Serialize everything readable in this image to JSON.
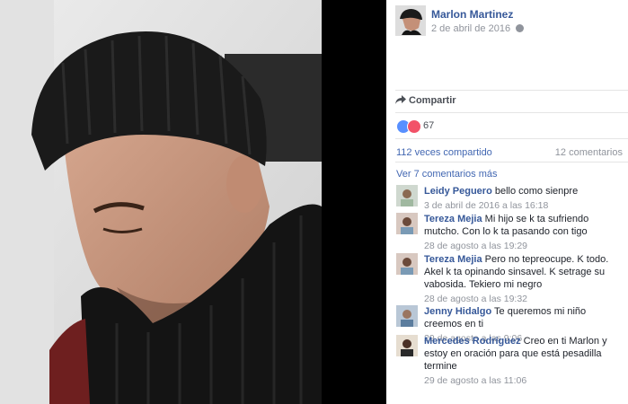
{
  "post": {
    "author": "Marlon Martinez",
    "date": "2 de abril de 2016",
    "privacy_icon": "globe-icon",
    "share_label": "Compartir",
    "reaction_count": "67",
    "shares_text": "112 veces compartido",
    "comments_text": "12 comentarios",
    "view_more": "Ver 7 comentarios más"
  },
  "comments": [
    {
      "author": "Leidy Peguero",
      "text": "bello como sienpre",
      "time": "3 de abril de 2016 a las 16:18"
    },
    {
      "author": "Tereza Mejia",
      "text": "Mi hijo se k ta sufriendo mutcho. Con lo k ta pasando con tigo",
      "time": "28 de agosto a las 19:29"
    },
    {
      "author": "Tereza Mejia",
      "text": "Pero no tepreocupe. K todo. Akel k ta opinando sinsavel. K setragе su vabosida. Tekiero mi negro",
      "time": "28 de agosto a las 19:32"
    },
    {
      "author": "Jenny Hidalgo",
      "text": "Te queremos mi niño creemos en ti",
      "time": "29 de agosto a las 9:06"
    },
    {
      "author": "Mercedes Rodriguez",
      "text": "Creo en ti Marlon y estoy en oración para que está pesadilla termine",
      "time": "29 de agosto a las 11:06"
    }
  ],
  "colors": {
    "link": "#365899",
    "like": "#5890ff",
    "love": "#f25268"
  }
}
